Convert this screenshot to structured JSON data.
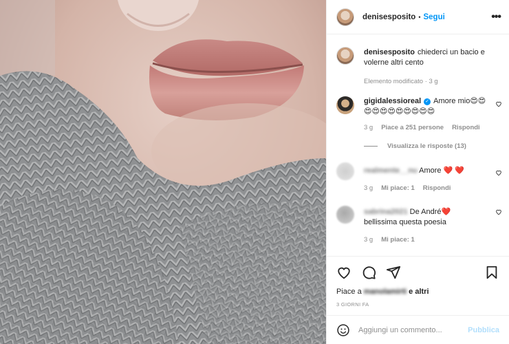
{
  "header": {
    "username": "denisesposito",
    "dot": "•",
    "follow": "Segui"
  },
  "caption": {
    "username": "denisesposito",
    "text": "chiederci un bacio e volerne altri cento",
    "edited": "Elemento modificato · 3 g"
  },
  "comments": [
    {
      "username": "gigidalessioreal",
      "text": "Amore mio😍😍😍😍😍😍😍😍😍😍😍",
      "age": "3 g",
      "likes": "Piace a 251 persone",
      "reply": "Rispondi",
      "view_replies": "Visualizza le risposte (13)"
    },
    {
      "username": "realmente__nu",
      "text": "Amore ❤️ ❤️",
      "age": "3 g",
      "likes": "Mi piace: 1",
      "reply": "Rispondi"
    },
    {
      "username": "sabrina2021",
      "text_prefix": "De André",
      "text_heart": "❤️",
      "text_line2": "bellissima questa poesia",
      "age": "3 g",
      "likes": "Mi piace: 1"
    }
  ],
  "likes_line": {
    "prefix": "Piace a ",
    "blurred_name": "manolamirti",
    "suffix": " e altri"
  },
  "date": "3 GIORNI FA",
  "add_comment": {
    "placeholder": "Aggiungi un commento...",
    "publish": "Pubblica"
  },
  "icons": {
    "more": "more-horizontal-icon",
    "like": "heart-icon",
    "comment": "comment-icon",
    "share": "paper-plane-icon",
    "save": "bookmark-icon",
    "emoji": "smiley-icon"
  },
  "colors": {
    "accent": "#0095f6",
    "publish_disabled": "#b2dffc",
    "meta": "#8e8e8e"
  }
}
